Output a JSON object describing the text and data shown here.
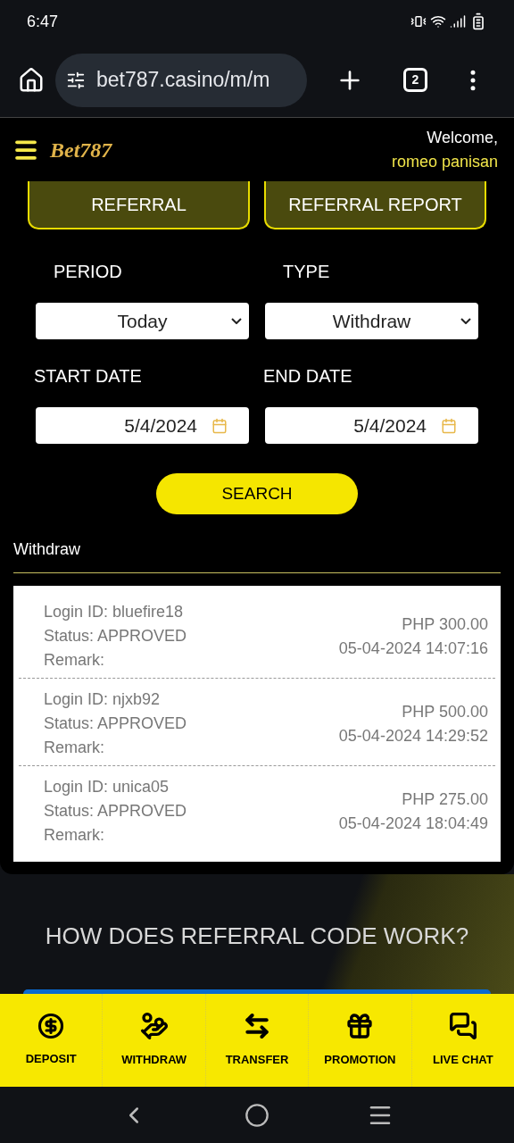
{
  "status_bar": {
    "time": "6:47"
  },
  "browser": {
    "url": "bet787.casino/m/m",
    "tab_count": "2"
  },
  "header": {
    "logo": "Bet787",
    "welcome": "Welcome,",
    "user": "romeo panisan"
  },
  "tabs": [
    {
      "label": "REFERRAL",
      "selected": false
    },
    {
      "label": "REFERRAL REPORT",
      "selected": false
    }
  ],
  "filters": {
    "period_label": "PERIOD",
    "period": "Today",
    "type_label": "TYPE",
    "type": "Withdraw",
    "start_label": "START DATE",
    "start": "5/4/2024",
    "end_label": "END DATE",
    "end": "5/4/2024",
    "search": "SEARCH"
  },
  "results": {
    "title": "Withdraw",
    "rows": [
      {
        "login": "Login ID: bluefire18",
        "status": "Status: APPROVED",
        "remark": "Remark:",
        "amount": "PHP 300.00",
        "date": "05-04-2024 14:07:16"
      },
      {
        "login": "Login ID: njxb92",
        "status": "Status: APPROVED",
        "remark": "Remark:",
        "amount": "PHP 500.00",
        "date": "05-04-2024 14:29:52"
      },
      {
        "login": "Login ID: unica05",
        "status": "Status: APPROVED",
        "remark": "Remark:",
        "amount": "PHP 275.00",
        "date": "05-04-2024 18:04:49"
      }
    ]
  },
  "info": {
    "heading": "HOW DOES REFERRAL CODE WORK?"
  },
  "bottom_nav": [
    {
      "kind": "deposit",
      "label": "DEPOSIT"
    },
    {
      "kind": "withdraw",
      "label": "WITHDRAW"
    },
    {
      "kind": "transfer",
      "label": "TRANSFER"
    },
    {
      "kind": "promotion",
      "label": "PROMOTION"
    },
    {
      "kind": "chat",
      "label": "LIVE CHAT"
    }
  ]
}
